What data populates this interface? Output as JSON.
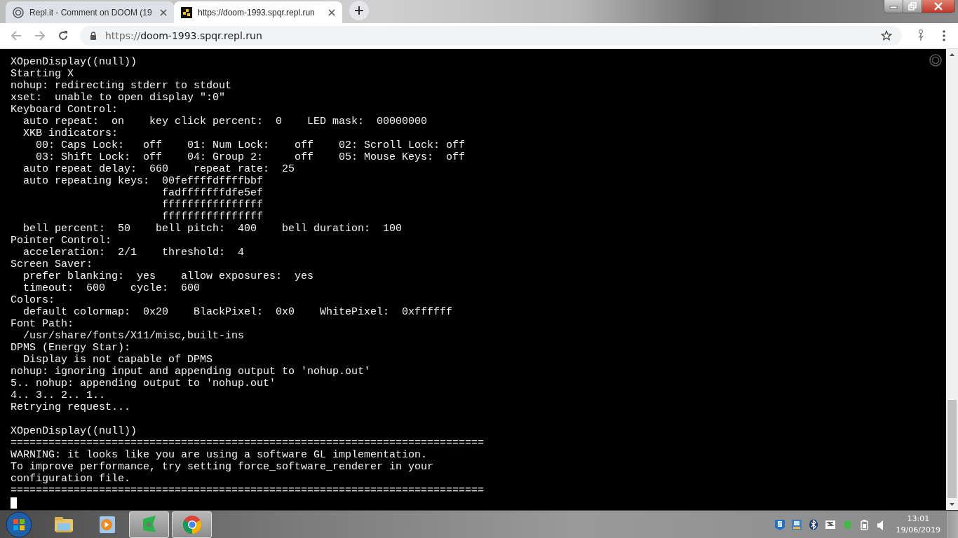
{
  "browser": {
    "tabs": [
      {
        "title": "Repl.it - Comment on DOOM (19",
        "kind": "replit",
        "selected": false
      },
      {
        "title": "https://doom-1993.spqr.repl.run",
        "kind": "site",
        "selected": true
      }
    ],
    "address": {
      "scheme": "https://",
      "host": "doom-1993.spqr.repl.run"
    }
  },
  "terminal": {
    "blocks": [
      [
        "XOpenDisplay((null))",
        "Starting X",
        "nohup: redirecting stderr to stdout",
        "xset:  unable to open display \":0\"",
        "Keyboard Control:",
        "  auto repeat:  on    key click percent:  0    LED mask:  00000000",
        "  XKB indicators:",
        "    00: Caps Lock:   off    01: Num Lock:    off    02: Scroll Lock: off",
        "    03: Shift Lock:  off    04: Group 2:     off    05: Mouse Keys:  off",
        "  auto repeat delay:  660    repeat rate:  25",
        "  auto repeating keys:  00feffffdffffbbf",
        "                        fadfffffffdfe5ef",
        "                        ffffffffffffffff",
        "                        ffffffffffffffff",
        "  bell percent:  50    bell pitch:  400    bell duration:  100",
        "Pointer Control:",
        "  acceleration:  2/1    threshold:  4",
        "Screen Saver:",
        "  prefer blanking:  yes    allow exposures:  yes",
        "  timeout:  600    cycle:  600",
        "Colors:",
        "  default colormap:  0x20    BlackPixel:  0x0    WhitePixel:  0xffffff",
        "Font Path:",
        "  /usr/share/fonts/X11/misc,built-ins",
        "DPMS (Energy Star):",
        "  Display is not capable of DPMS",
        "nohup: ignoring input and appending output to 'nohup.out'",
        "5.. nohup: appending output to 'nohup.out'",
        "4.. 3.. 2.. 1..",
        "Retrying request..."
      ],
      [
        "XOpenDisplay((null))",
        "===========================================================================",
        "WARNING: it looks like you are using a software GL implementation.",
        "To improve performance, try setting force_software_renderer in your",
        "configuration file.",
        "==========================================================================="
      ]
    ],
    "cursor": true
  },
  "taskbar": {
    "apps": [
      {
        "kind": "explorer",
        "running": false
      },
      {
        "kind": "media",
        "running": false
      },
      {
        "kind": "green",
        "running": true
      },
      {
        "kind": "chrome",
        "running": true
      }
    ],
    "clock": {
      "time": "13:01",
      "date": "19/06/2019"
    }
  }
}
